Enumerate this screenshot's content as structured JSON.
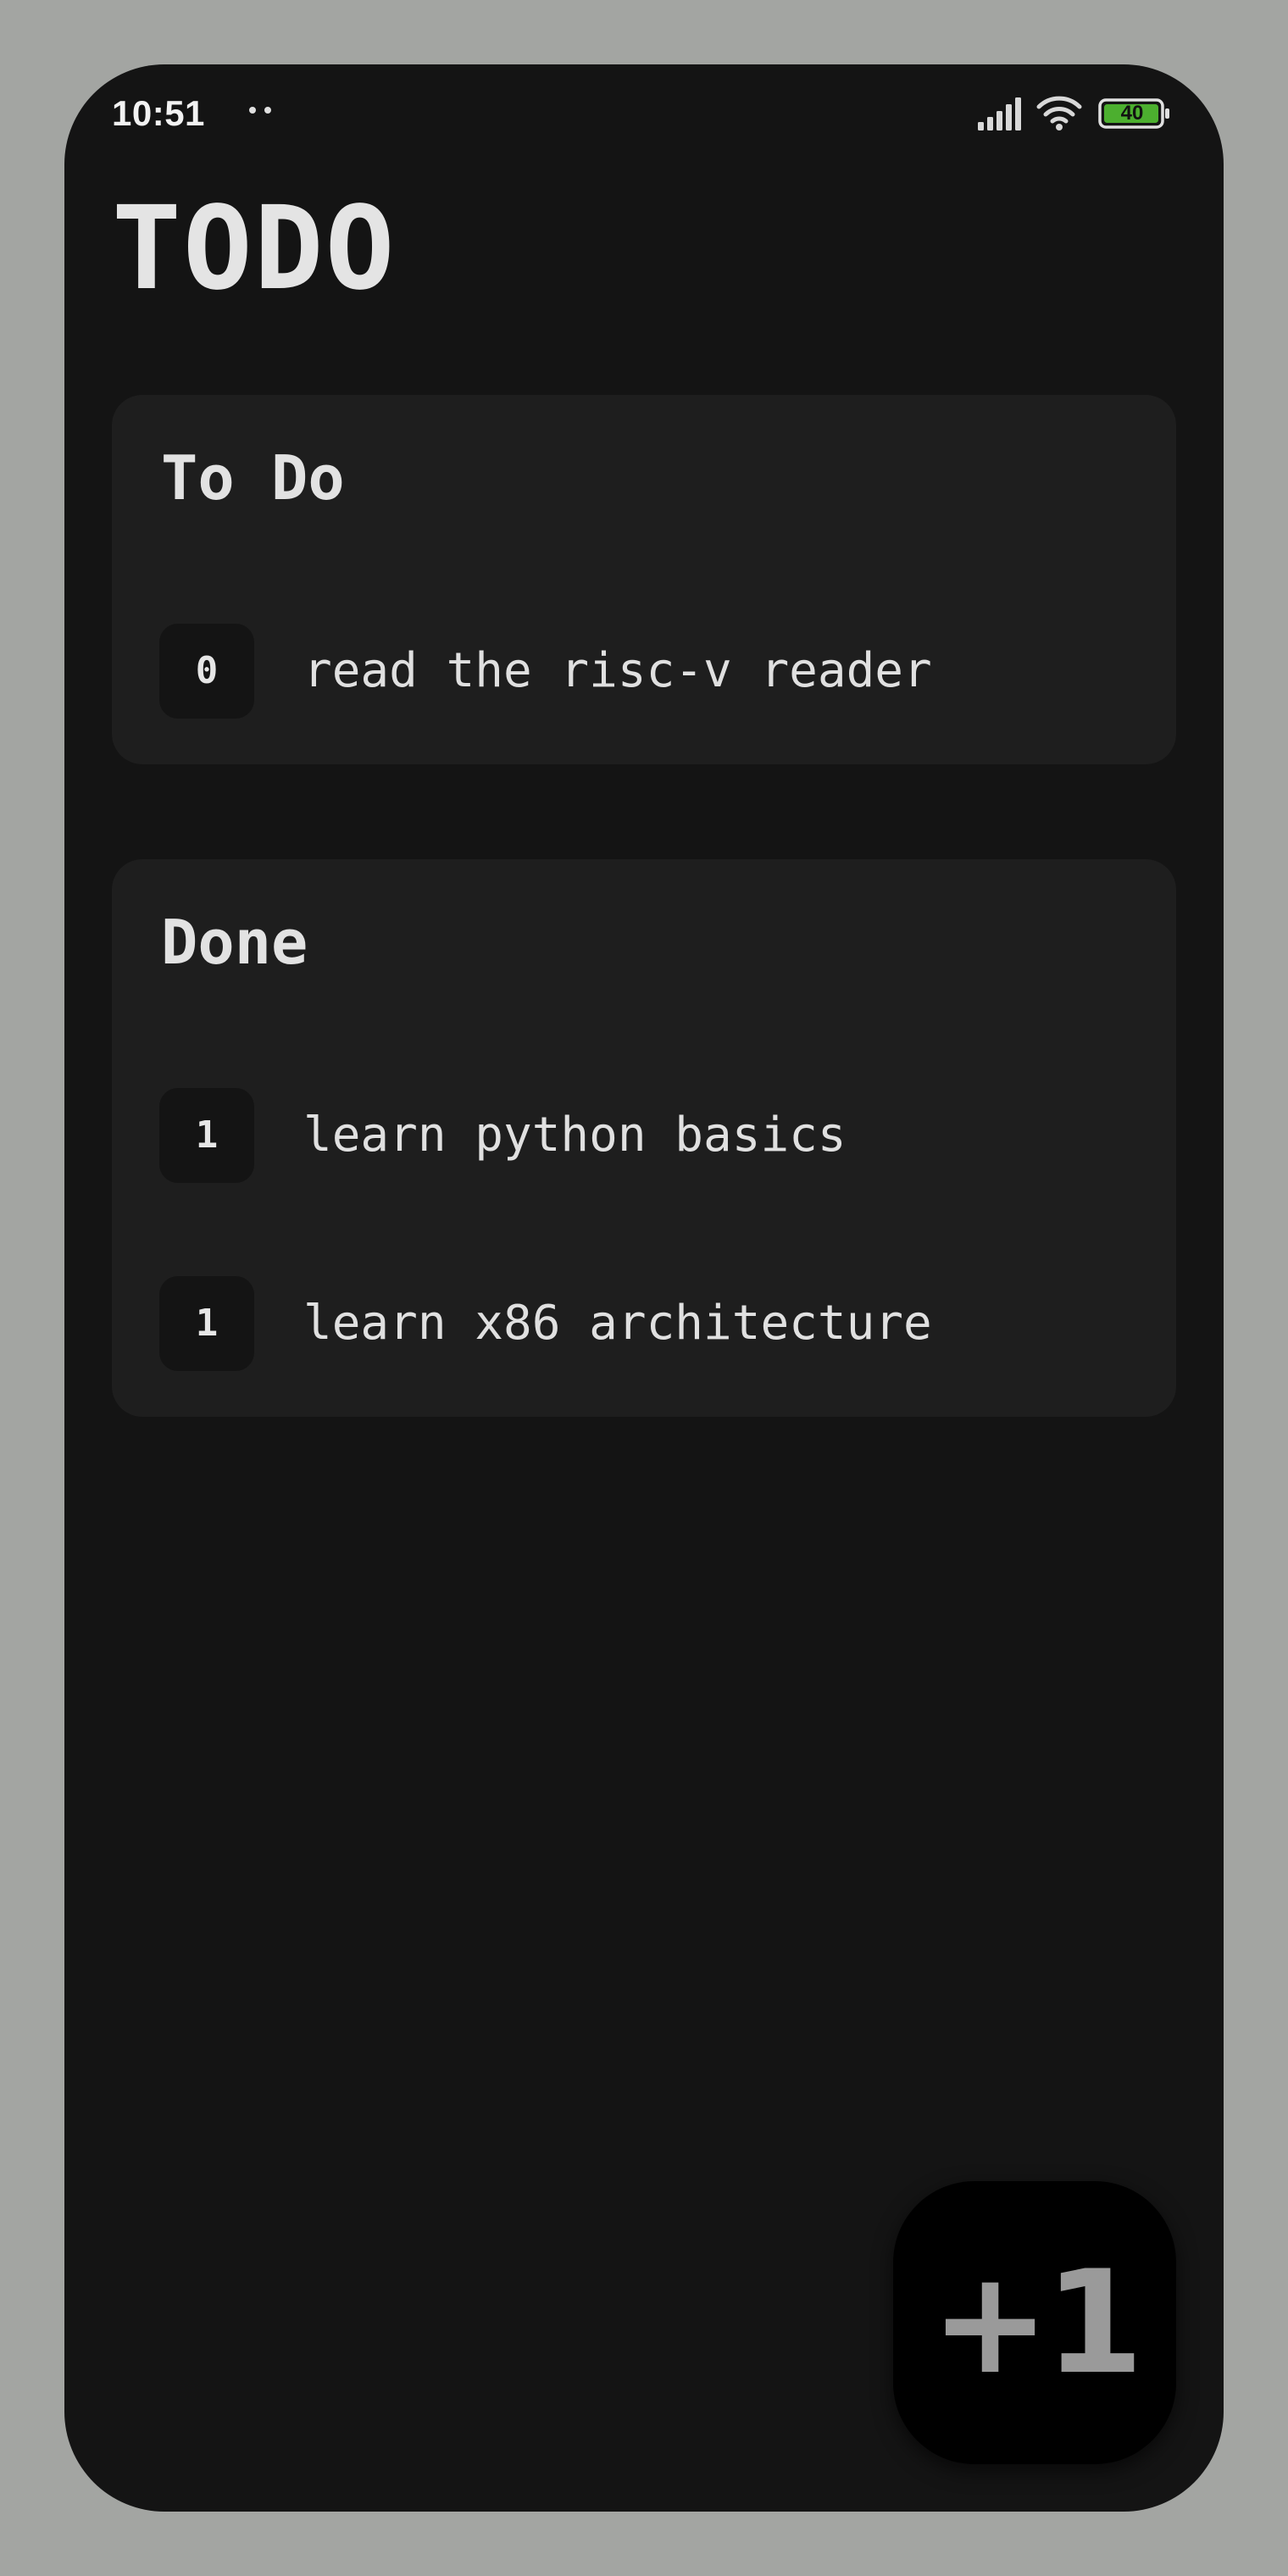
{
  "status_bar": {
    "time": "10:51",
    "battery_level": "40",
    "icons": [
      "notification-dots-icon",
      "signal-icon",
      "wifi-icon",
      "battery-icon"
    ],
    "battery_color": "#4caf2f"
  },
  "app": {
    "title": "TODO"
  },
  "sections": [
    {
      "heading": "To Do",
      "items": [
        {
          "count": "0",
          "text": "read the risc-v reader"
        }
      ]
    },
    {
      "heading": "Done",
      "items": [
        {
          "count": "1",
          "text": "learn python basics"
        },
        {
          "count": "1",
          "text": "learn x86 architecture"
        }
      ]
    }
  ],
  "fab": {
    "label": "+1"
  },
  "colors": {
    "background": "#a3a5a2",
    "screen": "#141414",
    "card": "#1e1e1e",
    "text": "#e2e2e2",
    "fab": "#000000",
    "fab_text": "#9a9a9a"
  }
}
